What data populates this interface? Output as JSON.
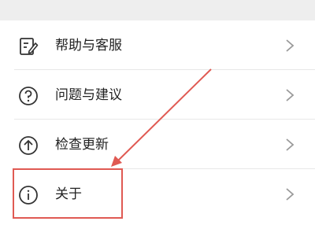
{
  "menu": {
    "items": [
      {
        "label": "帮助与客服",
        "icon": "edit-document-icon"
      },
      {
        "label": "问题与建议",
        "icon": "question-circle-icon"
      },
      {
        "label": "检查更新",
        "icon": "arrow-up-circle-icon"
      },
      {
        "label": "关于",
        "icon": "info-circle-icon"
      }
    ]
  },
  "annotation": {
    "color": "#e05a53"
  }
}
